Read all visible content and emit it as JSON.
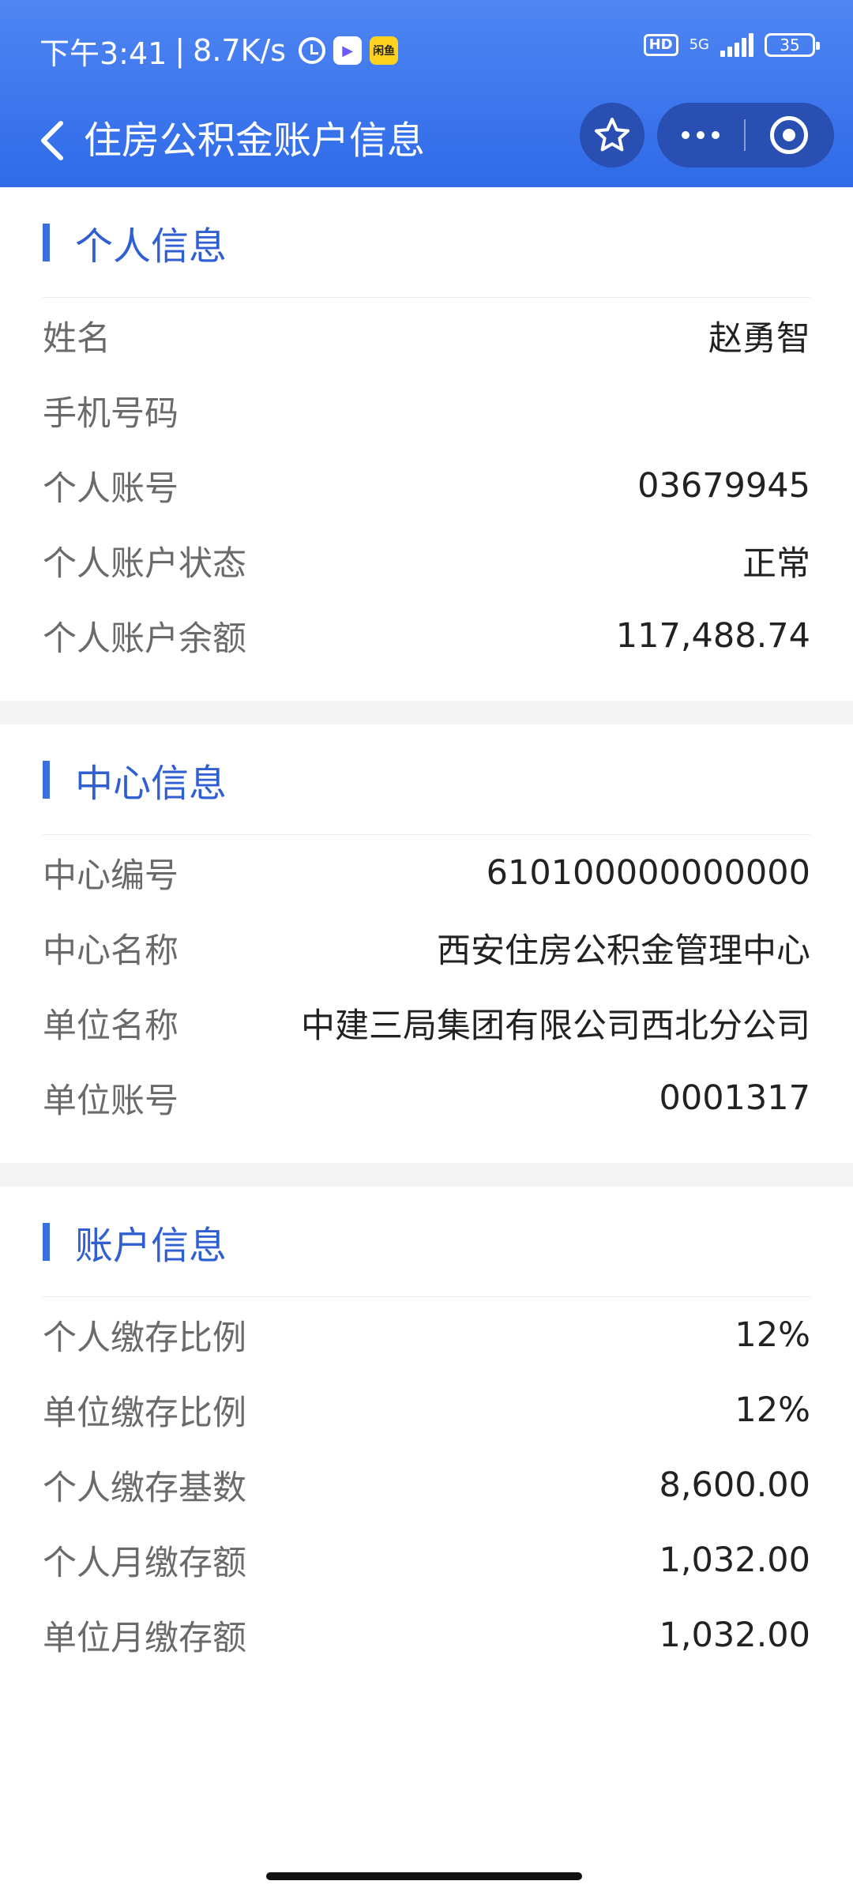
{
  "status_bar": {
    "time": "下午3:41",
    "separator": "|",
    "net_speed": "8.7K/s",
    "hd": "HD",
    "network": "5G",
    "battery": "35",
    "app_badge_play": "▶",
    "app_badge_yellow": "闲鱼"
  },
  "app_bar": {
    "title": "住房公积金账户信息"
  },
  "sections": {
    "personal": {
      "title": "个人信息",
      "rows": [
        {
          "label": "姓名",
          "value": "赵勇智"
        },
        {
          "label": "手机号码",
          "value": ""
        },
        {
          "label": "个人账号",
          "value": "03679945"
        },
        {
          "label": "个人账户状态",
          "value": "正常"
        },
        {
          "label": "个人账户余额",
          "value": "117,488.74"
        }
      ]
    },
    "center": {
      "title": "中心信息",
      "rows": [
        {
          "label": "中心编号",
          "value": "610100000000000"
        },
        {
          "label": "中心名称",
          "value": "西安住房公积金管理中心"
        },
        {
          "label": "单位名称",
          "value": "中建三局集团有限公司西北分公司"
        },
        {
          "label": "单位账号",
          "value": "0001317"
        }
      ]
    },
    "account": {
      "title": "账户信息",
      "rows": [
        {
          "label": "个人缴存比例",
          "value": "12%"
        },
        {
          "label": "单位缴存比例",
          "value": "12%"
        },
        {
          "label": "个人缴存基数",
          "value": "8,600.00"
        },
        {
          "label": "个人月缴存额",
          "value": "1,032.00"
        },
        {
          "label": "单位月缴存额",
          "value": "1,032.00"
        }
      ]
    }
  },
  "colors": {
    "header_top": "#4f86f3",
    "header_bottom": "#2f6ae8",
    "accent": "#3a6fe0",
    "section_title": "#2f5fd0",
    "label": "#6a6a6a",
    "value": "#222222"
  }
}
